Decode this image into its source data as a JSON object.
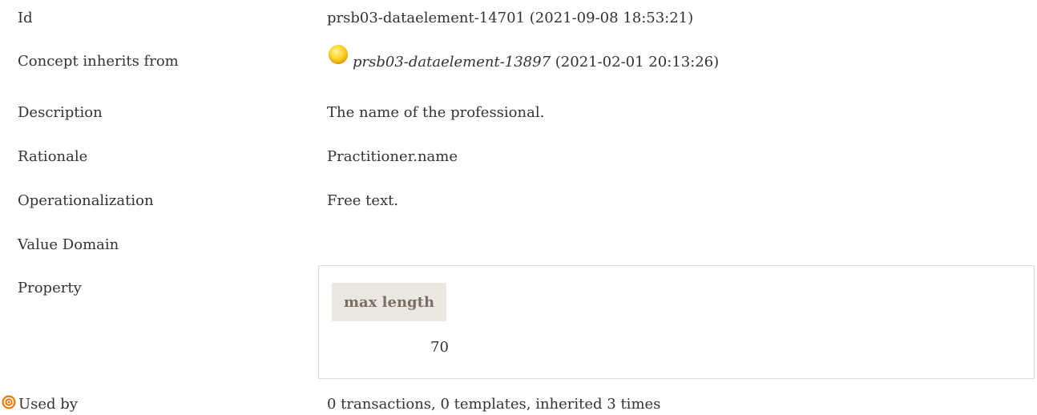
{
  "rows": {
    "id": {
      "label": "Id",
      "value": "prsb03-dataelement-14701 (2021-09-08 18:53:21)"
    },
    "inherits": {
      "label": "Concept inherits from",
      "link": "prsb03-dataelement-13897",
      "date": " (2021-02-01 20:13:26)",
      "icon": "yellow-circle-icon"
    },
    "description": {
      "label": "Description",
      "value": "The name of the professional."
    },
    "rationale": {
      "label": "Rationale",
      "value": "Practitioner.name"
    },
    "operationalization": {
      "label": "Operationalization",
      "value": "Free text."
    },
    "value_domain": {
      "label": "Value Domain"
    },
    "property": {
      "label": "Property",
      "header": "max length",
      "value": "70"
    },
    "used_by": {
      "label": "Used by",
      "icon": "target-icon",
      "value": "0 transactions, 0 templates, inherited 3 times"
    }
  },
  "colors": {
    "text": "#333333",
    "header_bg": "#ebe7e1",
    "header_text": "#7a6f63",
    "box_border": "#dddddd",
    "icon_orange": "#f07800",
    "icon_yellow": "#ffd83a"
  }
}
